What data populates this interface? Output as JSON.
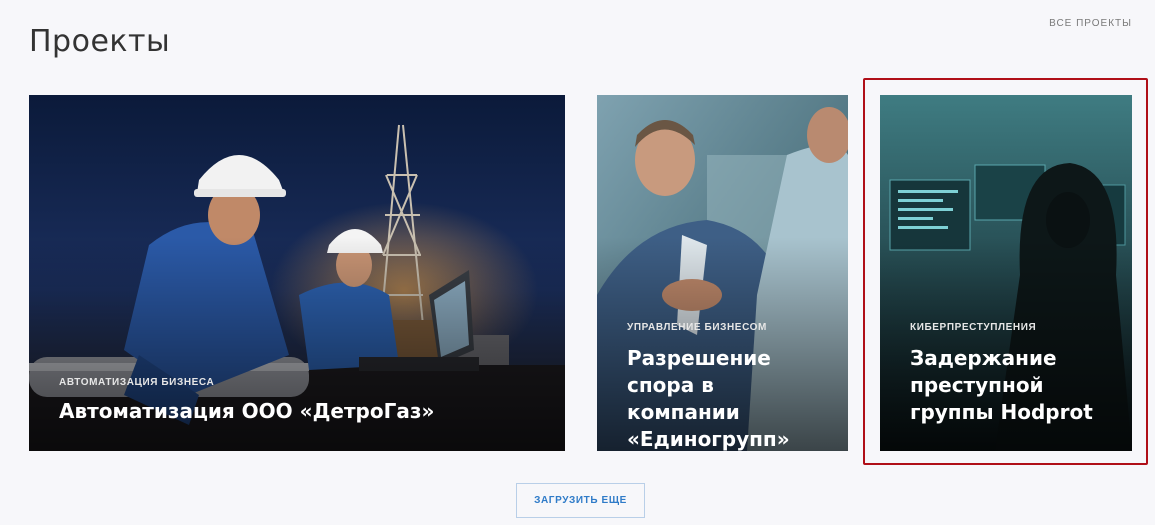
{
  "header": {
    "title": "Проекты",
    "all_projects_label": "ВСЕ ПРОЕКТЫ"
  },
  "cards": [
    {
      "category": "АВТОМАТИЗАЦИЯ БИЗНЕСА",
      "title": "Автоматизация ООО «ДетроГаз»",
      "image": "oil-rig-workers-night-photo",
      "helmet_logo": "detrogas"
    },
    {
      "category": "УПРАВЛЕНИЕ БИЗНЕСОМ",
      "title": "Разрешение спора в компании «Единогрупп»",
      "image": "business-handshake-photo"
    },
    {
      "category": "КИБЕРПРЕСТУПЛЕНИЯ",
      "title": "Задержание преступной группы Hodprot",
      "image": "hooded-hacker-monitors-photo"
    }
  ],
  "load_more_label": "ЗАГРУЗИТЬ ЕЩЕ",
  "colors": {
    "background": "#f7f7fa",
    "link_blue": "#2f7bc8",
    "highlight_red": "#b00f18"
  }
}
